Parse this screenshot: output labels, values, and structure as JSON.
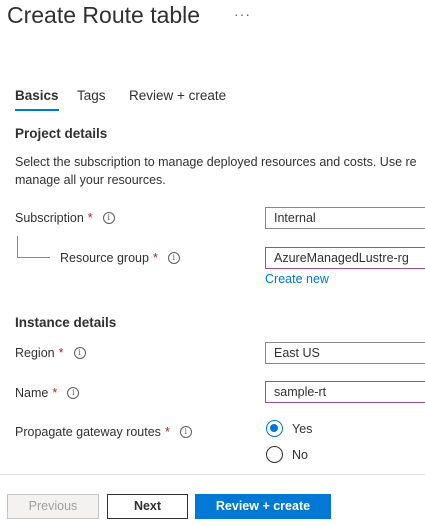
{
  "page": {
    "title": "Create Route table",
    "more_menu": "···"
  },
  "tabs": [
    {
      "label": "Basics",
      "active": true
    },
    {
      "label": "Tags",
      "active": false
    },
    {
      "label": "Review + create",
      "active": false
    }
  ],
  "project": {
    "heading": "Project details",
    "description_line1": "Select the subscription to manage deployed resources and costs. Use re",
    "description_line2": "manage all your resources."
  },
  "fields": {
    "subscription": {
      "label": "Subscription",
      "required": "*",
      "value": "Internal"
    },
    "resource_group": {
      "label": "Resource group",
      "required": "*",
      "value": "AzureManagedLustre-rg",
      "create_new": "Create new"
    },
    "region": {
      "label": "Region",
      "required": "*",
      "value": "East US"
    },
    "name": {
      "label": "Name",
      "required": "*",
      "value": "sample-rt"
    },
    "propagate": {
      "label": "Propagate gateway routes",
      "required": "*",
      "options": [
        "Yes",
        "No"
      ],
      "selected": "Yes"
    }
  },
  "instance": {
    "heading": "Instance details"
  },
  "info_glyph": "i",
  "footer": {
    "previous": "Previous",
    "next": "Next",
    "review_create": "Review + create"
  },
  "colors": {
    "accent": "#0078d4",
    "required": "#a4262c"
  }
}
